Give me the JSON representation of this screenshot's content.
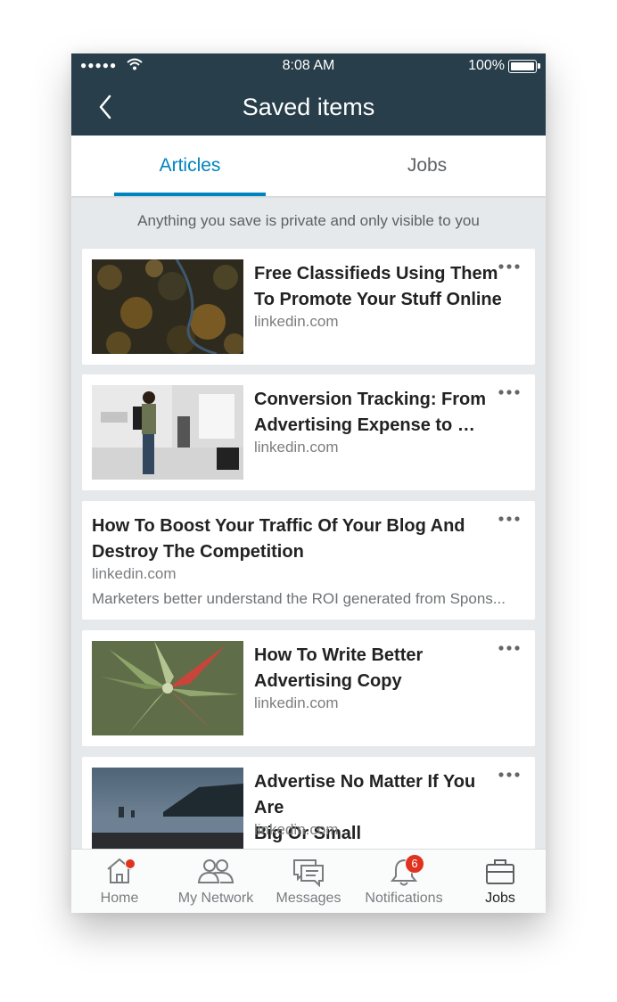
{
  "status_bar": {
    "signal": "●●●●●",
    "time": "8:08 AM",
    "battery": "100%"
  },
  "header": {
    "title": "Saved items"
  },
  "tabs": [
    {
      "label": "Articles",
      "active": true
    },
    {
      "label": "Jobs",
      "active": false
    }
  ],
  "notice": "Anything you save is private and only visible to you",
  "articles": [
    {
      "title_line1": "Free Classifieds Using Them",
      "title_line2": "To Promote Your Stuff Online",
      "source": "linkedin.com",
      "thumbnail": "aerial-forest-road"
    },
    {
      "title_line1": "Conversion Tracking: From",
      "title_line2": "Advertising Expense to …",
      "source": "linkedin.com",
      "thumbnail": "man-in-store"
    },
    {
      "title_line1": "How To Boost Your Traffic Of Your Blog And",
      "title_line2": "Destroy The Competition",
      "source": "linkedin.com",
      "description": "Marketers better understand the ROI generated from Spons..."
    },
    {
      "title_line1": "How To Write Better",
      "title_line2": "Advertising Copy",
      "source": "linkedin.com",
      "thumbnail": "succulent-plant"
    },
    {
      "title_line1": "Advertise No Matter If You Are",
      "title_line2": "Big Or Small",
      "source": "linkedin.com",
      "thumbnail": "coastal-cliffs"
    }
  ],
  "bottom_nav": [
    {
      "label": "Home",
      "icon": "home-icon"
    },
    {
      "label": "My Network",
      "icon": "network-icon"
    },
    {
      "label": "Messages",
      "icon": "messages-icon"
    },
    {
      "label": "Notifications",
      "icon": "bell-icon",
      "badge": "6"
    },
    {
      "label": "Jobs",
      "icon": "briefcase-icon",
      "active": true
    }
  ],
  "colors": {
    "header_bg": "#283e4a",
    "accent": "#0084bf",
    "badge": "#e0321f",
    "page_bg": "#e6e9ec"
  }
}
